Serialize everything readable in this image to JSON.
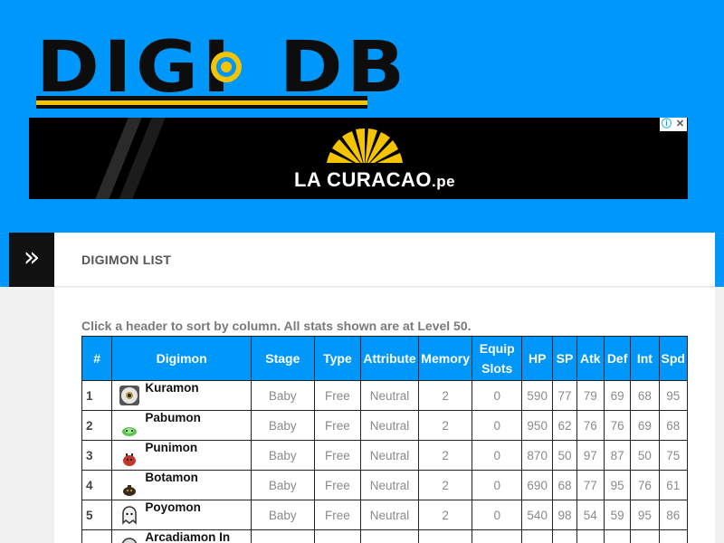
{
  "logo": {
    "part1": "DIGI",
    "part2": "DB"
  },
  "ad": {
    "brand": "LA CURACAO",
    "tld": ".pe",
    "info_icon": "info-icon",
    "close_icon": "close-icon"
  },
  "section": {
    "menu_icon": "double-chevron-right-icon",
    "title": "DIGIMON LIST"
  },
  "hint": "Click a header to sort by column. All stats shown are at Level 50.",
  "table": {
    "headers": {
      "num": "#",
      "digimon": "Digimon",
      "stage": "Stage",
      "type": "Type",
      "attribute": "Attribute",
      "memory": "Memory",
      "equip1": "Equip",
      "equip2": "Slots",
      "hp": "HP",
      "sp": "SP",
      "atk": "Atk",
      "def": "Def",
      "int": "Int",
      "spd": "Spd"
    },
    "rows": [
      {
        "num": "1",
        "name": "Kuramon",
        "stage": "Baby",
        "type": "Free",
        "attribute": "Neutral",
        "memory": "2",
        "equip": "0",
        "hp": "590",
        "sp": "77",
        "atk": "79",
        "def": "69",
        "int": "68",
        "spd": "95"
      },
      {
        "num": "2",
        "name": "Pabumon",
        "stage": "Baby",
        "type": "Free",
        "attribute": "Neutral",
        "memory": "2",
        "equip": "0",
        "hp": "950",
        "sp": "62",
        "atk": "76",
        "def": "76",
        "int": "69",
        "spd": "68"
      },
      {
        "num": "3",
        "name": "Punimon",
        "stage": "Baby",
        "type": "Free",
        "attribute": "Neutral",
        "memory": "2",
        "equip": "0",
        "hp": "870",
        "sp": "50",
        "atk": "97",
        "def": "87",
        "int": "50",
        "spd": "75"
      },
      {
        "num": "4",
        "name": "Botamon",
        "stage": "Baby",
        "type": "Free",
        "attribute": "Neutral",
        "memory": "2",
        "equip": "0",
        "hp": "690",
        "sp": "68",
        "atk": "77",
        "def": "95",
        "int": "76",
        "spd": "61"
      },
      {
        "num": "5",
        "name": "Poyomon",
        "stage": "Baby",
        "type": "Free",
        "attribute": "Neutral",
        "memory": "2",
        "equip": "0",
        "hp": "540",
        "sp": "98",
        "atk": "54",
        "def": "59",
        "int": "95",
        "spd": "86"
      },
      {
        "num": "",
        "name": "Arcadiamon In",
        "stage": "",
        "type": "",
        "attribute": "",
        "memory": "",
        "equip": "",
        "hp": "",
        "sp": "",
        "atk": "",
        "def": "",
        "int": "",
        "spd": ""
      }
    ]
  },
  "colors": {
    "background": "#0097fa",
    "header_cell": "#0097fa",
    "logo_accent": "#f5c400",
    "ad_fan": "#f5c400"
  }
}
